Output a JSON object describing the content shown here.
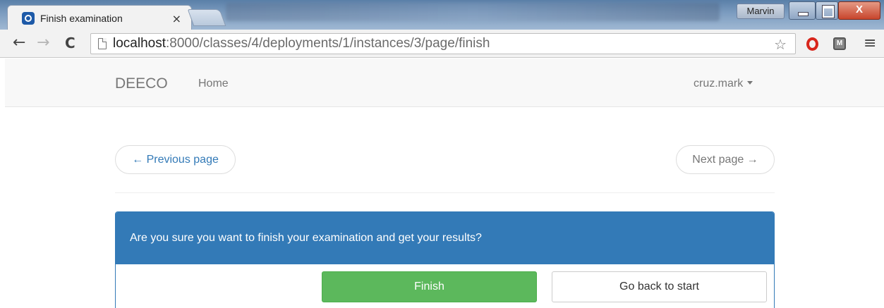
{
  "browser": {
    "tab": {
      "title": "Finish examination",
      "close_glyph": "×",
      "favicon": "app-logo-icon"
    },
    "profile_name": "Marvin",
    "window_buttons": {
      "close_glyph": "X"
    },
    "url": {
      "host": "localhost",
      "rest": ":8000/classes/4/deployments/1/instances/3/page/finish"
    },
    "icons": {
      "back": "←",
      "forward": "→",
      "reload": "C",
      "star": "☆",
      "menu": "≡",
      "extension_label": "M"
    }
  },
  "navbar": {
    "brand": "DEECO",
    "home": "Home",
    "user": "cruz.mark"
  },
  "pager": {
    "previous": "← Previous page",
    "next": "Next page →"
  },
  "panel": {
    "heading": "Are you sure you want to finish your examination and get your results?",
    "finish_label": "Finish",
    "back_label": "Go back to start"
  },
  "colors": {
    "primary": "#337ab7",
    "success": "#5cb85c",
    "navbar_bg": "#f8f8f8"
  }
}
